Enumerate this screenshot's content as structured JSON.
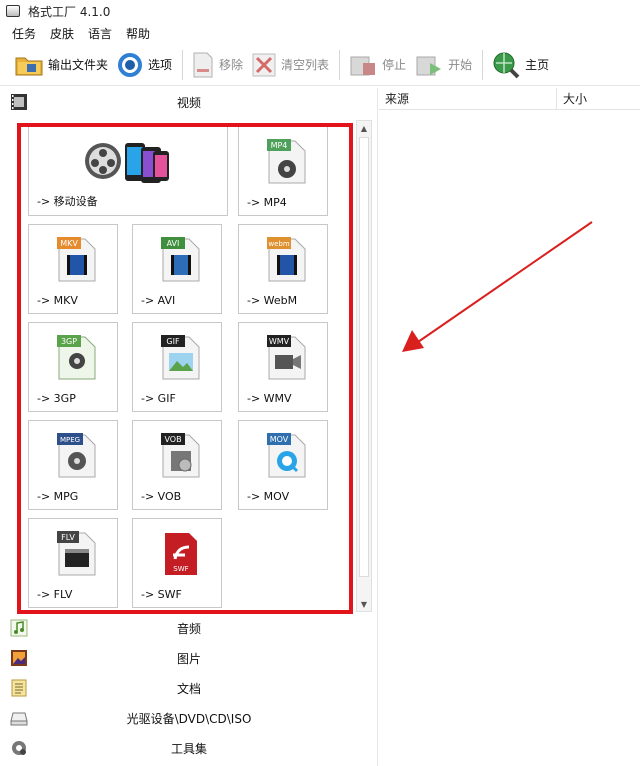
{
  "window": {
    "title": "格式工厂 4.1.0"
  },
  "menu": {
    "items": [
      "任务",
      "皮肤",
      "语言",
      "帮助"
    ]
  },
  "toolbar": {
    "output_folder": "输出文件夹",
    "options": "选项",
    "remove": "移除",
    "clear_list": "清空列表",
    "stop": "停止",
    "start": "开始",
    "home": "主页"
  },
  "categories": {
    "video": "视频",
    "audio": "音频",
    "image": "图片",
    "document": "文档",
    "disc": "光驱设备\\DVD\\CD\\ISO",
    "tools": "工具集"
  },
  "video_tiles": [
    {
      "label": "-> 移动设备",
      "badge": ""
    },
    {
      "label": "-> MP4",
      "badge": "MP4"
    },
    {
      "label": "-> MKV",
      "badge": "MKV"
    },
    {
      "label": "-> AVI",
      "badge": "AVI"
    },
    {
      "label": "-> WebM",
      "badge": "webm"
    },
    {
      "label": "-> 3GP",
      "badge": "3GP"
    },
    {
      "label": "-> GIF",
      "badge": "GIF"
    },
    {
      "label": "-> WMV",
      "badge": "WMV"
    },
    {
      "label": "-> MPG",
      "badge": "MPEG"
    },
    {
      "label": "-> VOB",
      "badge": "VOB"
    },
    {
      "label": "-> MOV",
      "badge": "MOV"
    },
    {
      "label": "-> FLV",
      "badge": "FLV"
    },
    {
      "label": "-> SWF",
      "badge": "SWF"
    }
  ],
  "task_list": {
    "columns": {
      "source": "来源",
      "size": "大小"
    }
  },
  "colors": {
    "highlight": "#e2131b",
    "arrow": "#d9201f"
  }
}
